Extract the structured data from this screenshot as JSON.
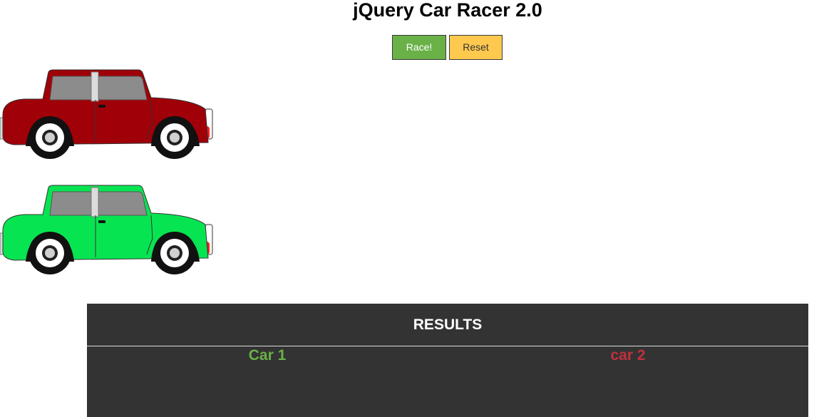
{
  "header": {
    "title": "jQuery Car Racer 2.0"
  },
  "controls": {
    "race_label": "Race!",
    "reset_label": "Reset",
    "race_color": "#6ab148",
    "reset_color": "#ffc94f"
  },
  "cars": [
    {
      "icon": "red-car-icon",
      "body_color": "#a00008"
    },
    {
      "icon": "green-car-icon",
      "body_color": "#07e451"
    }
  ],
  "results": {
    "title": "RESULTS",
    "car1_label": "Car 1",
    "car1_color": "#6ab148",
    "car2_label": "car 2",
    "car2_color": "#c0313d"
  }
}
